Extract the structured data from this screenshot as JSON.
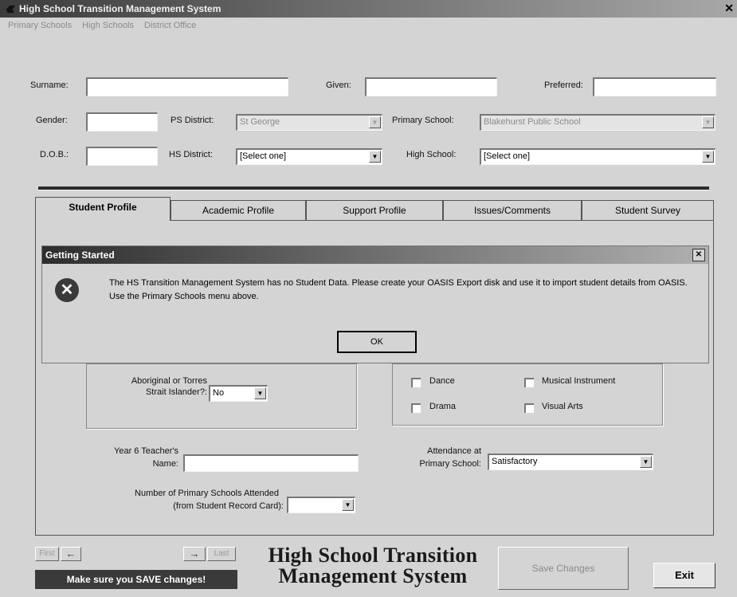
{
  "window": {
    "title": "High School Transition Management System",
    "close_glyph": "✕",
    "app_icon": "app-icon"
  },
  "menu": [
    "Primary Schools",
    "High Schools",
    "District Office"
  ],
  "form": {
    "surname_label": "Surname:",
    "surname_value": "",
    "given_label": "Given:",
    "given_value": "",
    "preferred_label": "Preferred:",
    "preferred_value": "",
    "gender_label": "Gender:",
    "gender_value": "",
    "ps_district_label": "PS District:",
    "ps_district_value": "St George",
    "primary_school_label": "Primary School:",
    "primary_school_value": "Blakehurst Public School",
    "dob_label": "D.O.B.:",
    "dob_value": "",
    "hs_district_label": "HS District:",
    "hs_district_value": "[Select one]",
    "high_school_label": "High School:",
    "high_school_value": "[Select one]"
  },
  "tabs": [
    "Student Profile",
    "Academic Profile",
    "Support Profile",
    "Issues/Comments",
    "Student Survey"
  ],
  "active_tab": "Student Profile",
  "dialog": {
    "title": "Getting Started",
    "close_glyph": "✕",
    "icon": "error-icon",
    "icon_glyph": "✕",
    "message": "The HS Transition Management System has no Student Data.  Please create your OASIS Export disk and use it to import student details from OASIS.  Use the Primary Schools menu above.",
    "ok_label": "OK"
  },
  "profile": {
    "aboriginal_label_1": "Aboriginal or Torres",
    "aboriginal_label_2": "Strait Islander?:",
    "aboriginal_value": "No",
    "arts": [
      {
        "label": "Dance",
        "checked": false
      },
      {
        "label": "Musical Instrument",
        "checked": false
      },
      {
        "label": "Drama",
        "checked": false
      },
      {
        "label": "Visual Arts",
        "checked": false
      }
    ],
    "teacher_label_1": "Year 6 Teacher's",
    "teacher_label_2": "Name:",
    "teacher_value": "",
    "attendance_label_1": "Attendance at",
    "attendance_label_2": "Primary School:",
    "attendance_value": "Satisfactory",
    "schools_attended_label_1": "Number of Primary Schools Attended",
    "schools_attended_label_2": "(from Student Record Card):",
    "schools_attended_value": ""
  },
  "footer": {
    "first_label": "First",
    "prev_icon": "arrow-left-icon",
    "prev_glyph": "←",
    "next_icon": "arrow-right-icon",
    "next_glyph": "→",
    "last_label": "Last",
    "save_reminder": "Make sure you SAVE changes!",
    "brand_line1": "High School Transition",
    "brand_line2": "Management System",
    "save_changes_label": "Save Changes",
    "exit_label": "Exit"
  },
  "dropdown_glyph": "▼"
}
